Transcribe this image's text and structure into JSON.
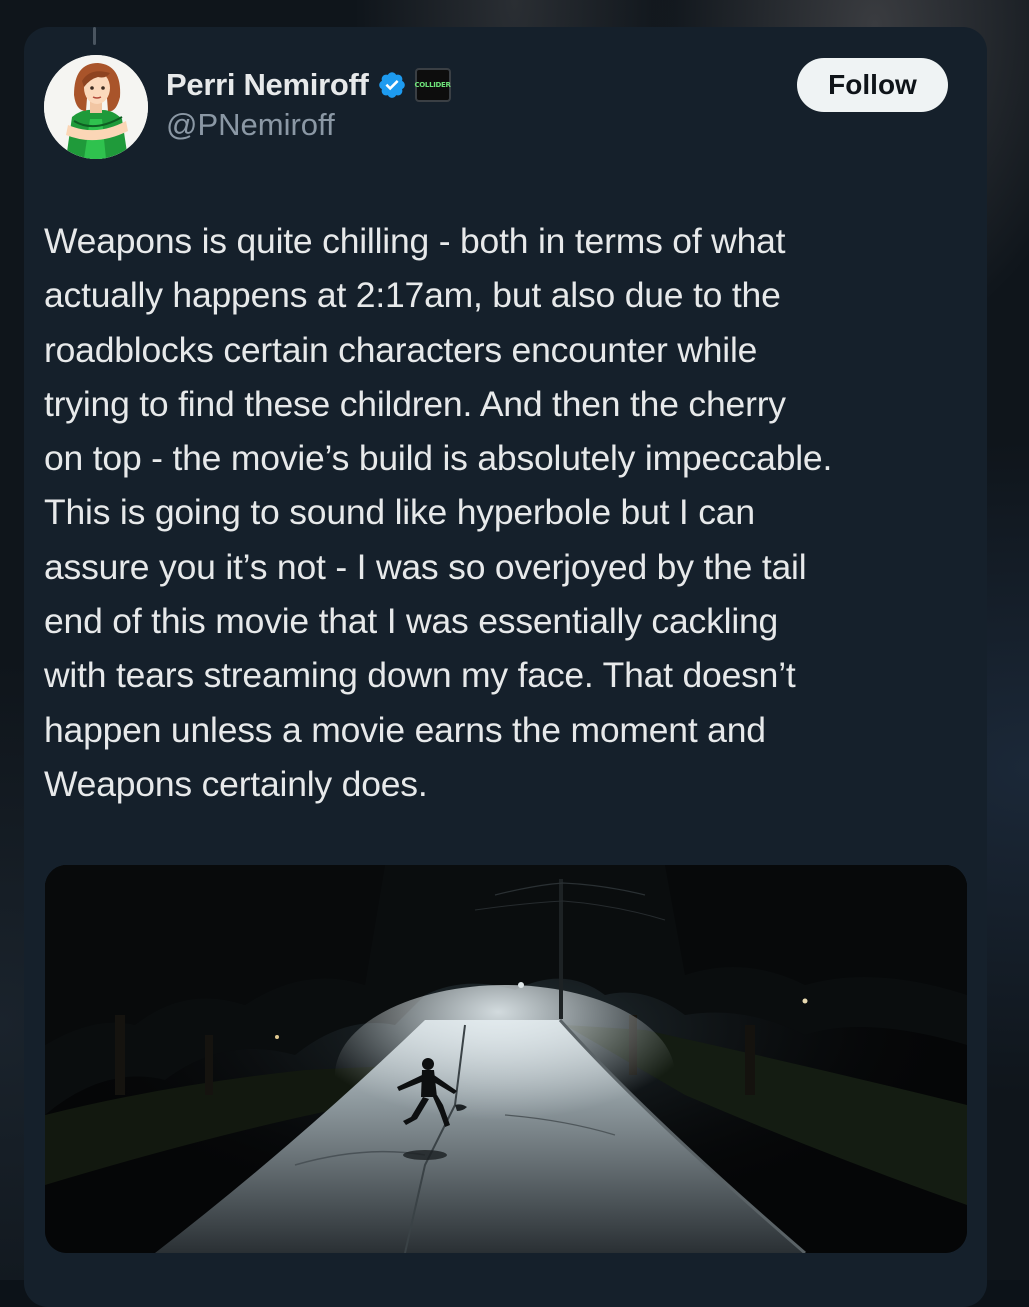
{
  "author": {
    "name": "Perri Nemiroff",
    "handle": "@PNemiroff",
    "verified_icon": "verified-badge-icon",
    "affiliate_badge_text": "COLLIDER"
  },
  "follow_button": {
    "label": "Follow"
  },
  "tweet": {
    "lines": [
      "Weapons is quite chilling - both in terms of what",
      "actually happens at 2:17am, but also due to the",
      "roadblocks certain characters encounter while",
      "trying to find these children. And then the cherry",
      "on top - the movie’s build is absolutely impeccable.",
      "This is going to sound like hyperbole but I can",
      "assure you it’s not - I was so overjoyed by the tail",
      "end of this movie that I was essentially cackling",
      "with tears streaming down my face. That doesn’t",
      "happen unless a movie earns the moment and",
      "Weapons certainly does."
    ]
  },
  "colors": {
    "card_background": "#15202b",
    "text_primary": "#e7e9ea",
    "text_secondary": "#8b98a5",
    "verified_blue": "#1d9bf0",
    "follow_button_bg": "#eff3f4"
  }
}
